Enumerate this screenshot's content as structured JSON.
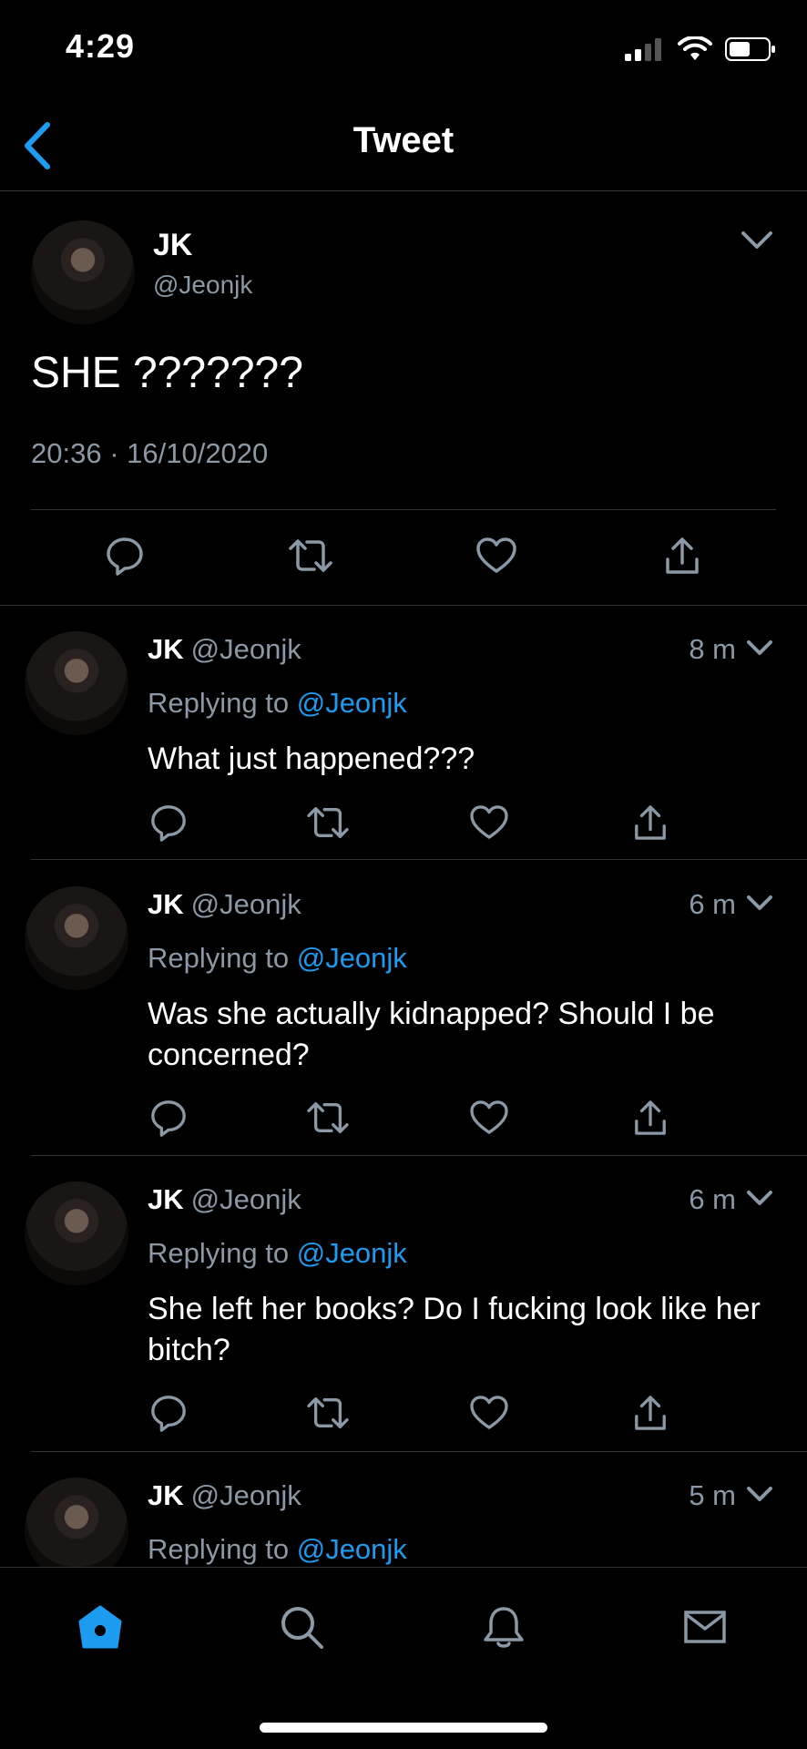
{
  "status_bar": {
    "time": "4:29"
  },
  "nav": {
    "title": "Tweet"
  },
  "colors": {
    "accent": "#1d9bf0",
    "muted": "#8b98a5",
    "background": "#000000",
    "divider": "#2f3336"
  },
  "main_tweet": {
    "name": "JK",
    "handle": "@Jeonjk",
    "text": "SHE ???????",
    "meta": "20:36 · 16/10/2020"
  },
  "replies": [
    {
      "name": "JK",
      "handle": "@Jeonjk",
      "time": "8 m",
      "replying_label": "Replying to",
      "replying_to": "@Jeonjk",
      "text": "What just happened???"
    },
    {
      "name": "JK",
      "handle": "@Jeonjk",
      "time": "6 m",
      "replying_label": "Replying to",
      "replying_to": "@Jeonjk",
      "text": "Was she actually kidnapped? Should I be concerned?"
    },
    {
      "name": "JK",
      "handle": "@Jeonjk",
      "time": "6 m",
      "replying_label": "Replying to",
      "replying_to": "@Jeonjk",
      "text": "She left her books? Do I fucking look like her bitch?"
    },
    {
      "name": "JK",
      "handle": "@Jeonjk",
      "time": "5 m",
      "replying_label": "Replying to",
      "replying_to": "@Jeonjk",
      "text": ""
    }
  ],
  "icons": {
    "actions": [
      "reply-icon",
      "retweet-icon",
      "like-icon",
      "share-icon"
    ],
    "tabs": [
      "home-icon",
      "search-icon",
      "notifications-icon",
      "messages-icon"
    ]
  }
}
